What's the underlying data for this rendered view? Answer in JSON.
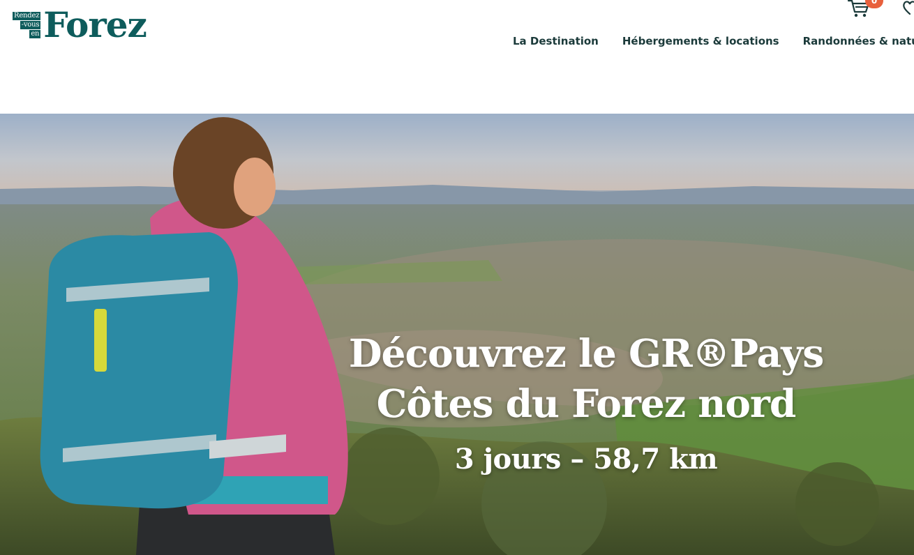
{
  "logo": {
    "tag_line1": "Rendez",
    "tag_line2": "-vous",
    "tag_line3": "en",
    "word": "Forez"
  },
  "nav": {
    "items": [
      {
        "label": "La Destination"
      },
      {
        "label": "Hébergements & locations"
      },
      {
        "label": "Randonnées & nature"
      }
    ]
  },
  "cart": {
    "count": "0",
    "icon": "cart-icon"
  },
  "favorites": {
    "icon": "heart-icon"
  },
  "hero": {
    "title_line1": "Découvrez le GR®Pays",
    "title_line2": "Côtes du Forez nord",
    "subtitle": "3 jours – 58,7 km"
  },
  "colors": {
    "brand": "#0e5c5c",
    "accent": "#e8603c",
    "text": "#1b3a3a"
  }
}
